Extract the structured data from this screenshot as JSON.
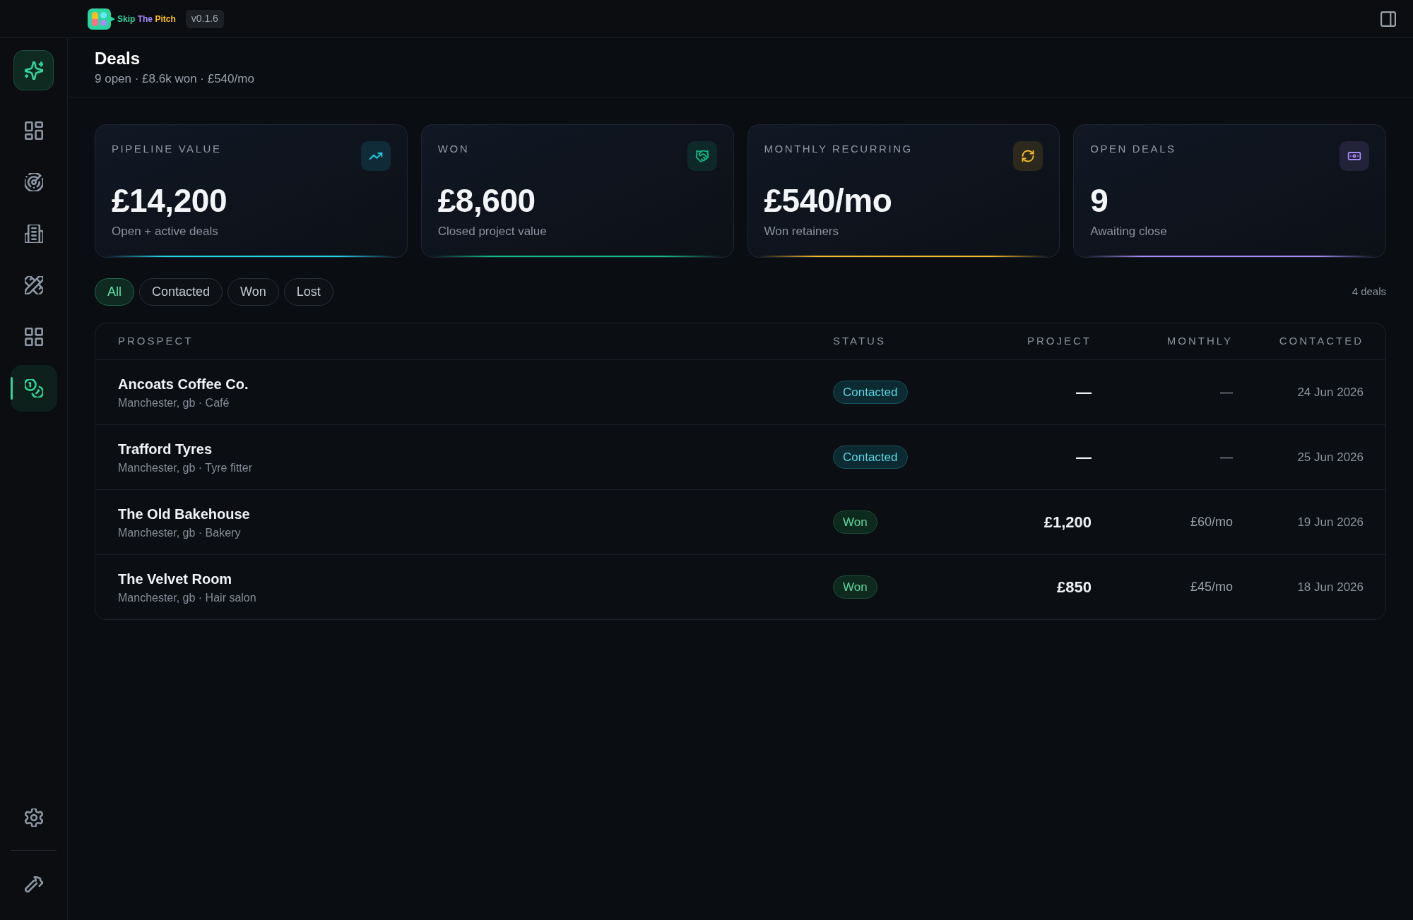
{
  "app": {
    "brand": "Skip The Pitch",
    "version": "v0.1.6"
  },
  "sidebar": {
    "items": [
      {
        "kind": "dashboard",
        "selected": false
      },
      {
        "kind": "radar",
        "selected": false
      },
      {
        "kind": "building",
        "selected": false
      },
      {
        "kind": "tools",
        "selected": false
      },
      {
        "kind": "grid",
        "selected": false
      },
      {
        "kind": "coins",
        "selected": true
      }
    ],
    "footer_items": [
      {
        "kind": "settings",
        "selected": false
      },
      {
        "kind": "hammer",
        "selected": false
      }
    ]
  },
  "page": {
    "title": "Deals",
    "subtitle": "9 open · £8.6k won · £540/mo"
  },
  "stats": [
    {
      "kind": "trend",
      "label": "PIPELINE VALUE",
      "value": "£14,200",
      "caption": "Open + active deals",
      "color": "#22d3ee"
    },
    {
      "kind": "handshake",
      "label": "WON",
      "value": "£8,600",
      "caption": "Closed project value",
      "color": "#10b981"
    },
    {
      "kind": "refresh",
      "label": "MONTHLY RECURRING",
      "value": "£540/mo",
      "caption": "Won retainers",
      "color": "#f5b829"
    },
    {
      "kind": "cash",
      "label": "OPEN DEALS",
      "value": "9",
      "caption": "Awaiting close",
      "color": "#a78bfa"
    }
  ],
  "filters": [
    {
      "label": "All",
      "selected": true
    },
    {
      "label": "Contacted",
      "selected": false
    },
    {
      "label": "Won",
      "selected": false
    },
    {
      "label": "Lost",
      "selected": false
    }
  ],
  "deal_count": "4 deals",
  "table": {
    "columns": [
      "PROSPECT",
      "STATUS",
      "PROJECT",
      "MONTHLY",
      "CONTACTED"
    ],
    "rows": [
      {
        "name": "Ancoats Coffee Co.",
        "details": "Manchester, gb · Café",
        "status": {
          "label": "Contacted",
          "kind": "contacted"
        },
        "project": "—",
        "monthly": "—",
        "contacted": "24 Jun 2026"
      },
      {
        "name": "Trafford Tyres",
        "details": "Manchester, gb · Tyre fitter",
        "status": {
          "label": "Contacted",
          "kind": "contacted"
        },
        "project": "—",
        "monthly": "—",
        "contacted": "25 Jun 2026"
      },
      {
        "name": "The Old Bakehouse",
        "details": "Manchester, gb · Bakery",
        "status": {
          "label": "Won",
          "kind": "won"
        },
        "project": "£1,200",
        "monthly": "£60/mo",
        "contacted": "19 Jun 2026"
      },
      {
        "name": "The Velvet Room",
        "details": "Manchester, gb · Hair salon",
        "status": {
          "label": "Won",
          "kind": "won"
        },
        "project": "£850",
        "monthly": "£45/mo",
        "contacted": "18 Jun 2026"
      }
    ]
  }
}
